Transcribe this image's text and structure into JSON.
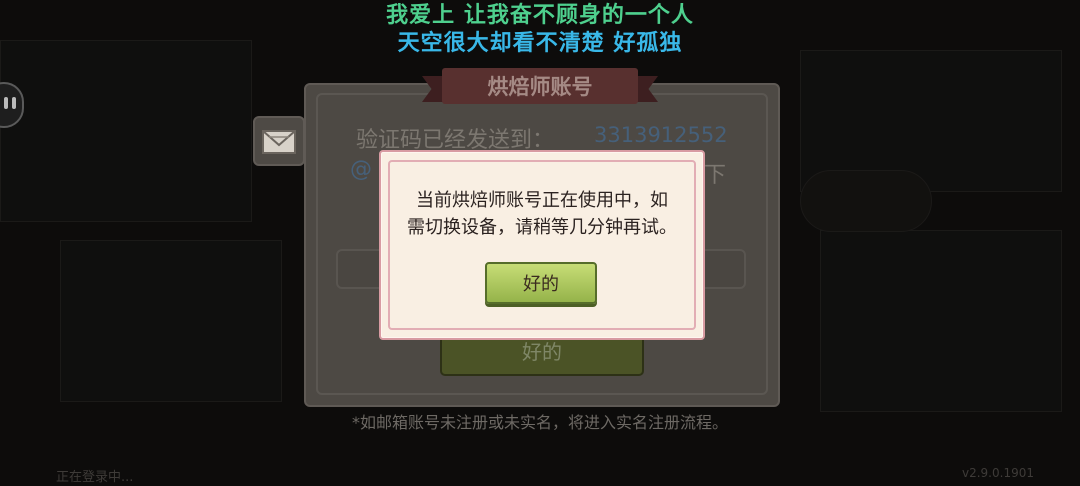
{
  "lyrics": {
    "line1": "我爱上 让我奋不顾身的一个人",
    "line2": "天空很大却看不清楚 好孤独",
    "line1_color": "#4ed08e",
    "line2_color": "#39b8e8"
  },
  "login_panel": {
    "title": "烘焙师账号",
    "code_sent_label": "验证码已经发送到：",
    "email_partial": "3313912552",
    "email_at": "@",
    "continue_suffix": "下",
    "ok_label": "好的",
    "mail_icon": "envelope-icon"
  },
  "footnote": "*如邮箱账号未注册或未实名，将进入实名注册流程。",
  "bottom_left": "正在登录中...",
  "bottom_right": "v2.9.0.1901",
  "modal": {
    "message_line1": "当前烘焙师账号正在使用中，如",
    "message_line2": "需切换设备，请稍等几分钟再试。",
    "ok_label": "好的",
    "accent": "#d89ba2",
    "button_color": "#b5cf62"
  }
}
